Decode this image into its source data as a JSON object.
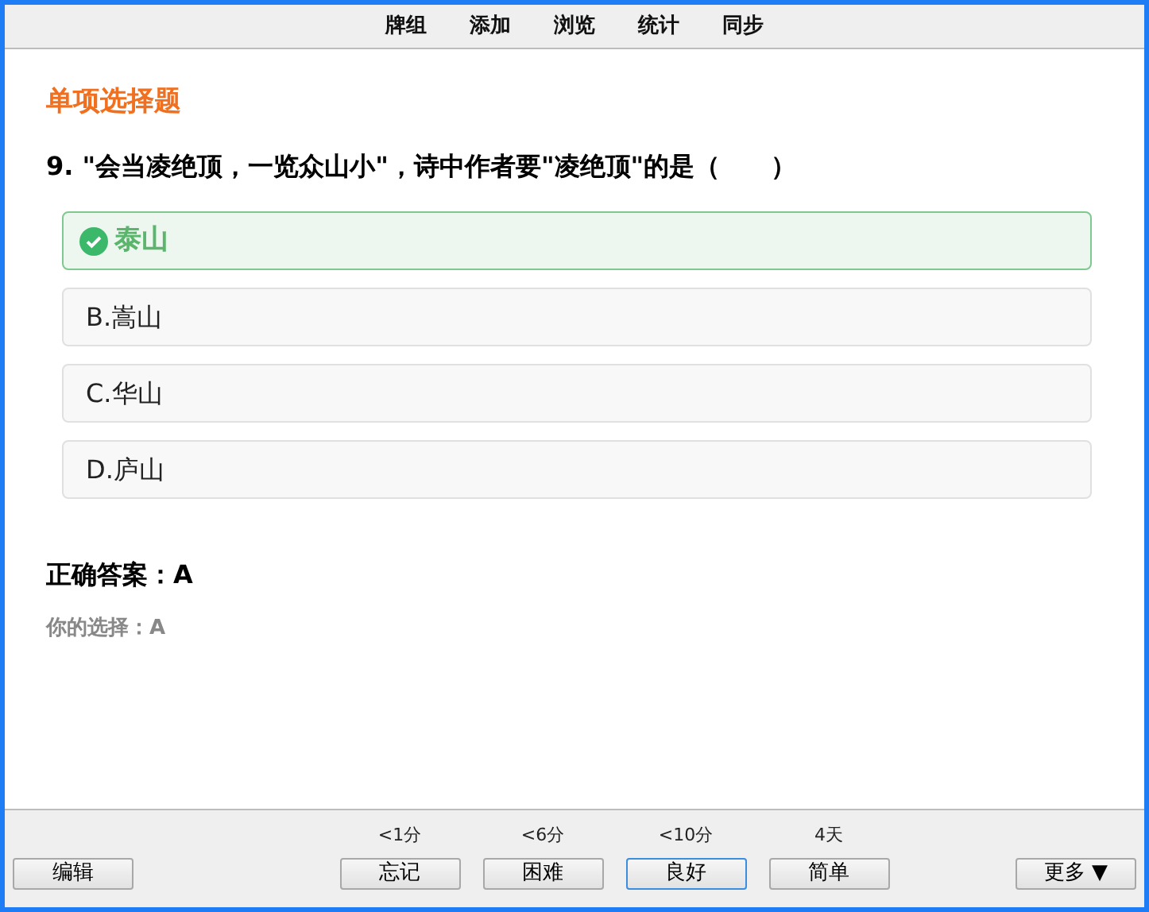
{
  "menu": [
    "牌组",
    "添加",
    "浏览",
    "统计",
    "同步"
  ],
  "question_type": "单项选择题",
  "question": "9. \"会当凌绝顶，一览众山小\"，诗中作者要\"凌绝顶\"的是（　　）",
  "options": [
    {
      "text": "泰山",
      "correct": true
    },
    {
      "text": "B.嵩山",
      "correct": false
    },
    {
      "text": "C.华山",
      "correct": false
    },
    {
      "text": "D.庐山",
      "correct": false
    }
  ],
  "correct_answer": "正确答案：A",
  "your_choice": "你的选择：A",
  "edit_button": "编辑",
  "ease_buttons": [
    {
      "interval": "<1分",
      "label": "忘记",
      "focused": false
    },
    {
      "interval": "<6分",
      "label": "困难",
      "focused": false
    },
    {
      "interval": "<10分",
      "label": "良好",
      "focused": true
    },
    {
      "interval": "4天",
      "label": "简单",
      "focused": false
    }
  ],
  "more_button": "更多 ▼"
}
